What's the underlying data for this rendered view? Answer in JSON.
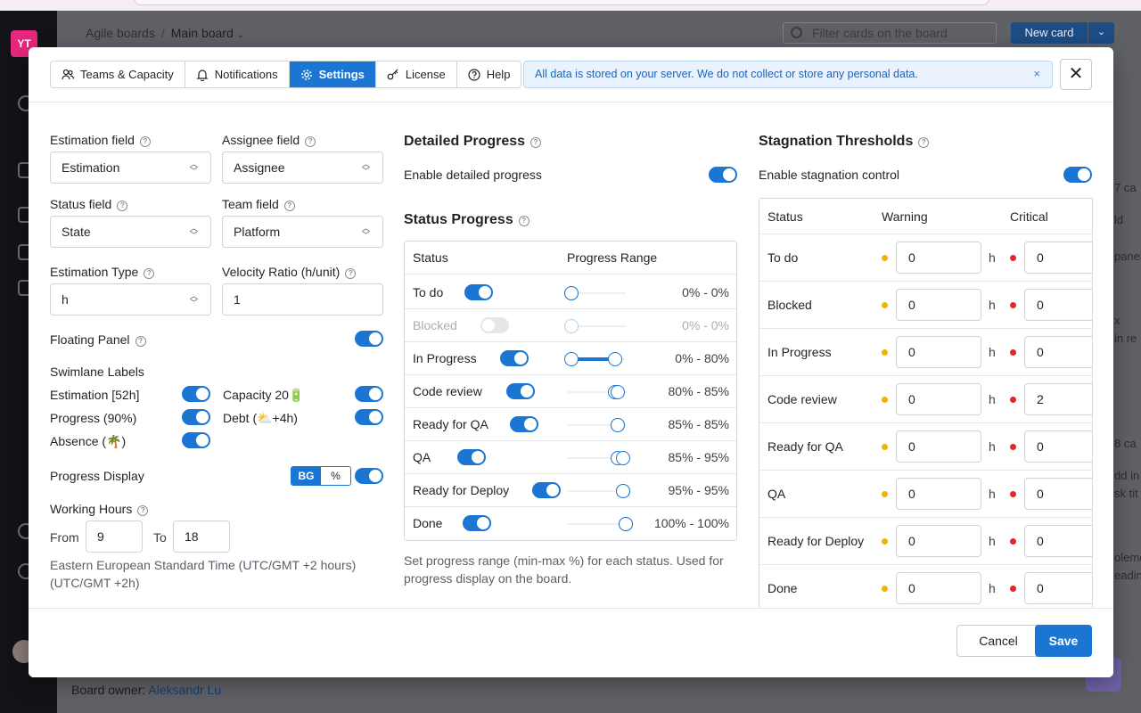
{
  "background": {
    "logo_text": "YT",
    "breadcrumb": [
      "Agile boards",
      "Main board"
    ],
    "filter_placeholder": "Filter cards on the board",
    "new_card_label": "New card",
    "board_owner_label": "Board owner:",
    "board_owner_name": "Aleksandr Lu",
    "right_column_fragments": [
      "7 ca",
      "ld",
      "panel",
      "x",
      "in re",
      "8 ca",
      "dd in",
      "sk tit",
      "oleme",
      "eadin"
    ]
  },
  "modal": {
    "tabs": [
      {
        "label": "Teams & Capacity",
        "icon": "users-icon",
        "active": false
      },
      {
        "label": "Notifications",
        "icon": "bell-icon",
        "active": false
      },
      {
        "label": "Settings",
        "icon": "gear-icon",
        "active": true
      },
      {
        "label": "License",
        "icon": "key-icon",
        "active": false
      },
      {
        "label": "Help",
        "icon": "help-icon",
        "active": false
      }
    ],
    "notice": "All data is stored on your server. We do not collect or store any personal data.",
    "notice_close": "×",
    "close": "✕",
    "cancel_label": "Cancel",
    "save_label": "Save",
    "accent_color": "#1a76d2"
  },
  "left": {
    "estimation_field_label": "Estimation field",
    "estimation_field_value": "Estimation",
    "assignee_field_label": "Assignee field",
    "assignee_field_value": "Assignee",
    "status_field_label": "Status field",
    "status_field_value": "State",
    "team_field_label": "Team field",
    "team_field_value": "Platform",
    "estimation_type_label": "Estimation Type",
    "estimation_type_value": "h",
    "velocity_ratio_label": "Velocity Ratio (h/unit)",
    "velocity_ratio_value": "1",
    "floating_panel_label": "Floating Panel",
    "floating_panel_on": true,
    "swimlane_labels_title": "Swimlane Labels",
    "swimlane_items": [
      {
        "label": "Estimation [52h]",
        "on": true
      },
      {
        "label": "Capacity 20🔋",
        "on": true
      },
      {
        "label": "Progress (90%)",
        "on": true
      },
      {
        "label": "Debt (⛅+4h)",
        "on": true
      },
      {
        "label": "Absence (🌴)",
        "on": true
      }
    ],
    "progress_display_label": "Progress Display",
    "progress_display_options": [
      "BG",
      "%"
    ],
    "progress_display_selected": "BG",
    "progress_display_on": true,
    "working_hours_label": "Working Hours",
    "from_label": "From",
    "from_value": "9",
    "to_label": "To",
    "to_value": "18",
    "timezone_text": "Eastern European Standard Time (UTC/GMT +2 hours) (UTC/GMT +2h)"
  },
  "middle": {
    "detailed_progress_title": "Detailed Progress",
    "enable_detailed_label": "Enable detailed progress",
    "enable_detailed_on": true,
    "status_progress_title": "Status Progress",
    "table_headers": [
      "Status",
      "Progress Range"
    ],
    "rows": [
      {
        "status": "To do",
        "on": true,
        "min": 0,
        "max": 0,
        "range": "0% - 0%"
      },
      {
        "status": "Blocked",
        "on": false,
        "min": 0,
        "max": 0,
        "range": "0% - 0%"
      },
      {
        "status": "In Progress",
        "on": true,
        "min": 0,
        "max": 80,
        "range": "0% - 80%"
      },
      {
        "status": "Code review",
        "on": true,
        "min": 80,
        "max": 85,
        "range": "80% - 85%"
      },
      {
        "status": "Ready for QA",
        "on": true,
        "min": 85,
        "max": 85,
        "range": "85% - 85%"
      },
      {
        "status": "QA",
        "on": true,
        "min": 85,
        "max": 95,
        "range": "85% - 95%"
      },
      {
        "status": "Ready for Deploy",
        "on": true,
        "min": 95,
        "max": 95,
        "range": "95% - 95%"
      },
      {
        "status": "Done",
        "on": true,
        "min": 100,
        "max": 100,
        "range": "100% - 100%"
      }
    ],
    "footnote": "Set progress range (min-max %) for each status. Used for progress display on the board."
  },
  "right": {
    "title": "Stagnation Thresholds",
    "enable_label": "Enable stagnation control",
    "enable_on": true,
    "headers": [
      "Status",
      "Warning",
      "Critical"
    ],
    "unit": "h",
    "warning_color": "#f0b400",
    "critical_color": "#e5252a",
    "rows": [
      {
        "status": "To do",
        "warning": "0",
        "critical": "0"
      },
      {
        "status": "Blocked",
        "warning": "0",
        "critical": "0"
      },
      {
        "status": "In Progress",
        "warning": "0",
        "critical": "0"
      },
      {
        "status": "Code review",
        "warning": "0",
        "critical": "2"
      },
      {
        "status": "Ready for QA",
        "warning": "0",
        "critical": "0"
      },
      {
        "status": "QA",
        "warning": "0",
        "critical": "0"
      },
      {
        "status": "Ready for Deploy",
        "warning": "0",
        "critical": "0"
      },
      {
        "status": "Done",
        "warning": "0",
        "critical": "0"
      }
    ]
  }
}
